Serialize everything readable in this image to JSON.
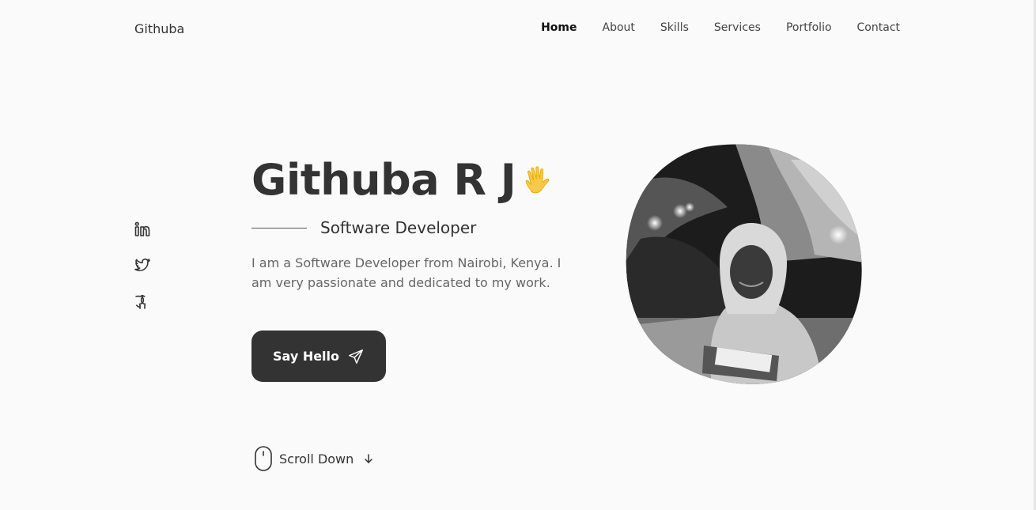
{
  "header": {
    "logo": "Githuba",
    "nav": [
      {
        "label": "Home",
        "active": true
      },
      {
        "label": "About",
        "active": false
      },
      {
        "label": "Skills",
        "active": false
      },
      {
        "label": "Services",
        "active": false
      },
      {
        "label": "Portfolio",
        "active": false
      },
      {
        "label": "Contact",
        "active": false
      }
    ]
  },
  "social": [
    {
      "icon": "linkedin-icon"
    },
    {
      "icon": "twitter-icon"
    },
    {
      "icon": "github-icon"
    }
  ],
  "hero": {
    "name": "Githuba R J",
    "wave_icon": "waving-hand-icon",
    "title": "Software Developer",
    "description": "I am a Software Developer from Nairobi, Kenya. I am very passionate and dedicated to my work.",
    "cta_label": "Say Hello",
    "cta_icon": "send-icon",
    "scroll_label": "Scroll Down"
  },
  "colors": {
    "background": "#fafafa",
    "text": "#333333",
    "muted": "#666666",
    "button": "#333333"
  }
}
